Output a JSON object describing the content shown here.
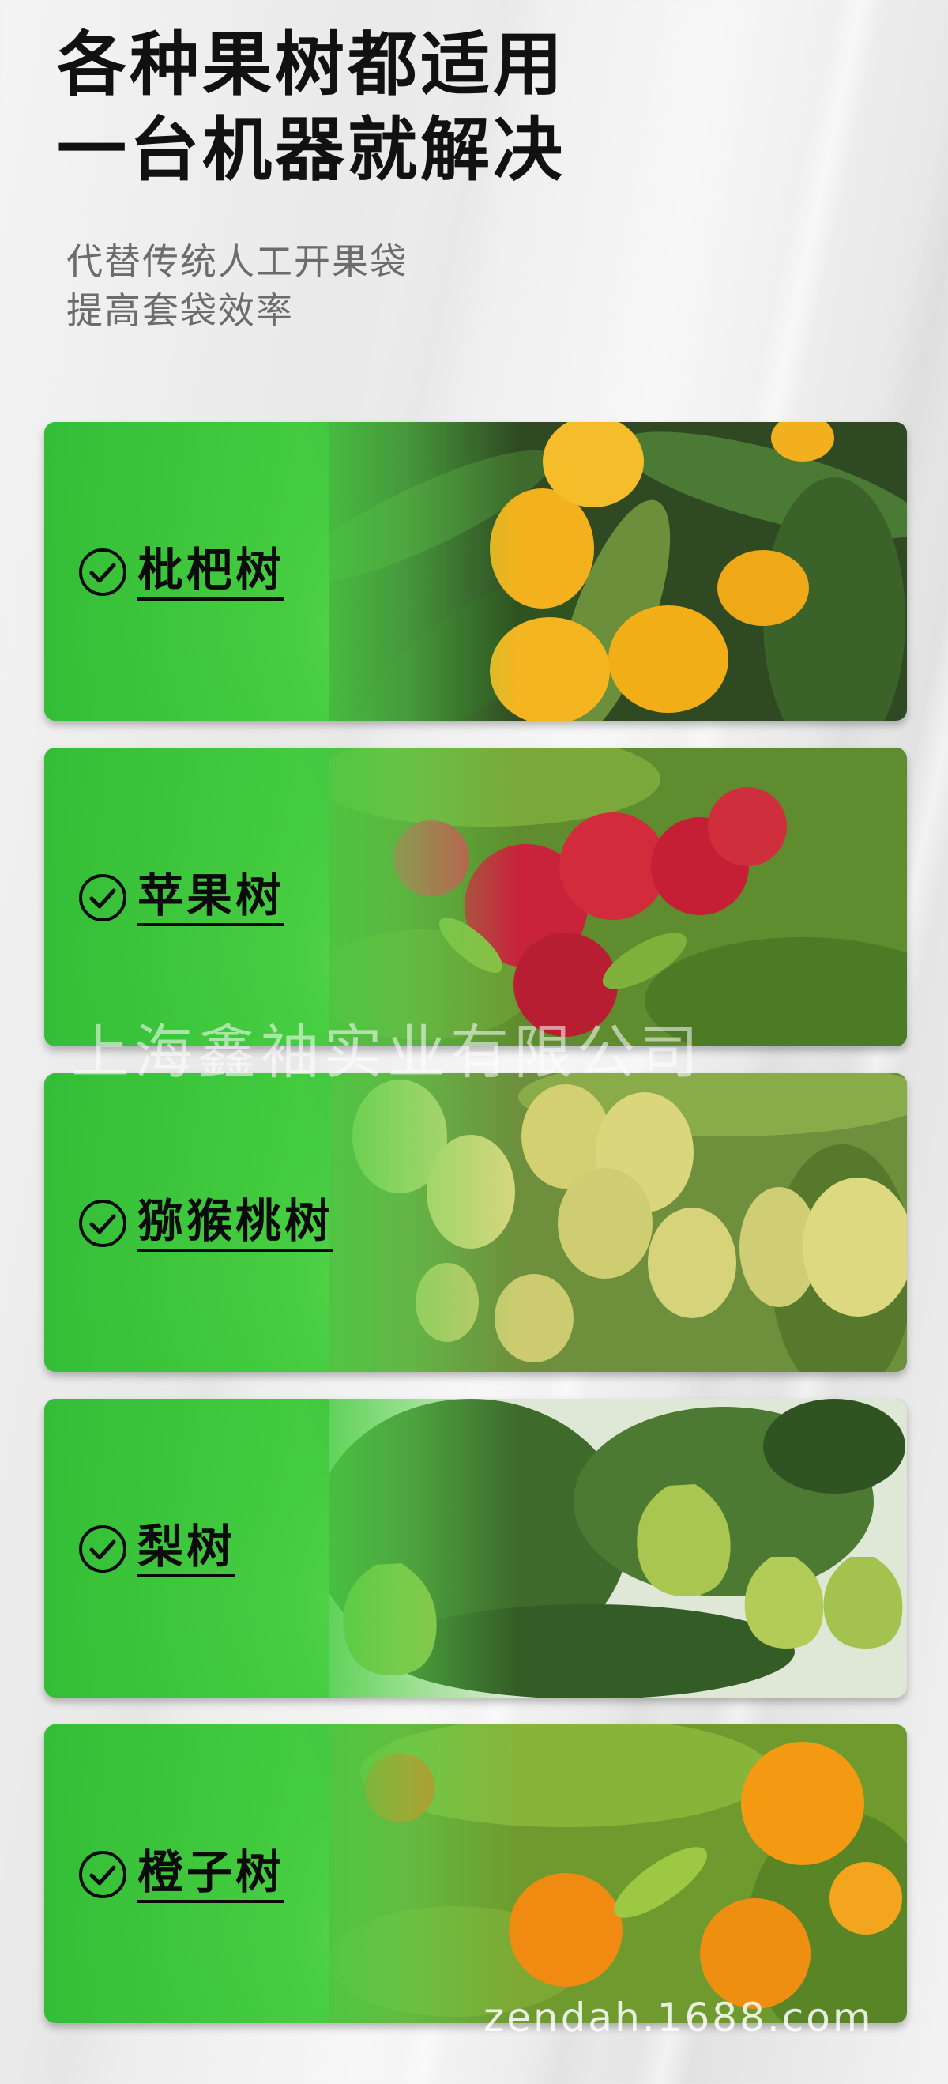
{
  "header": {
    "headline_line1": "各种果树都适用",
    "headline_line2": "一台机器就解决",
    "subline_line1": "代替传统人工开果袋",
    "subline_line2": "提高套袋效率"
  },
  "cards": [
    {
      "label": "枇杷树",
      "icon": "check-circle-icon",
      "fruit": "loquat"
    },
    {
      "label": "苹果树",
      "icon": "check-circle-icon",
      "fruit": "apple"
    },
    {
      "label": "猕猴桃树",
      "icon": "check-circle-icon",
      "fruit": "kiwi"
    },
    {
      "label": "梨树",
      "icon": "check-circle-icon",
      "fruit": "pear"
    },
    {
      "label": "橙子树",
      "icon": "check-circle-icon",
      "fruit": "orange"
    }
  ],
  "watermark": "上海鑫袖实业有限公司",
  "footer_mark": "zendah.1688.com",
  "colors": {
    "green_dark": "#16a52b",
    "green_light": "#7fe35a",
    "headline": "#111111",
    "subline": "#6c6c6c"
  }
}
